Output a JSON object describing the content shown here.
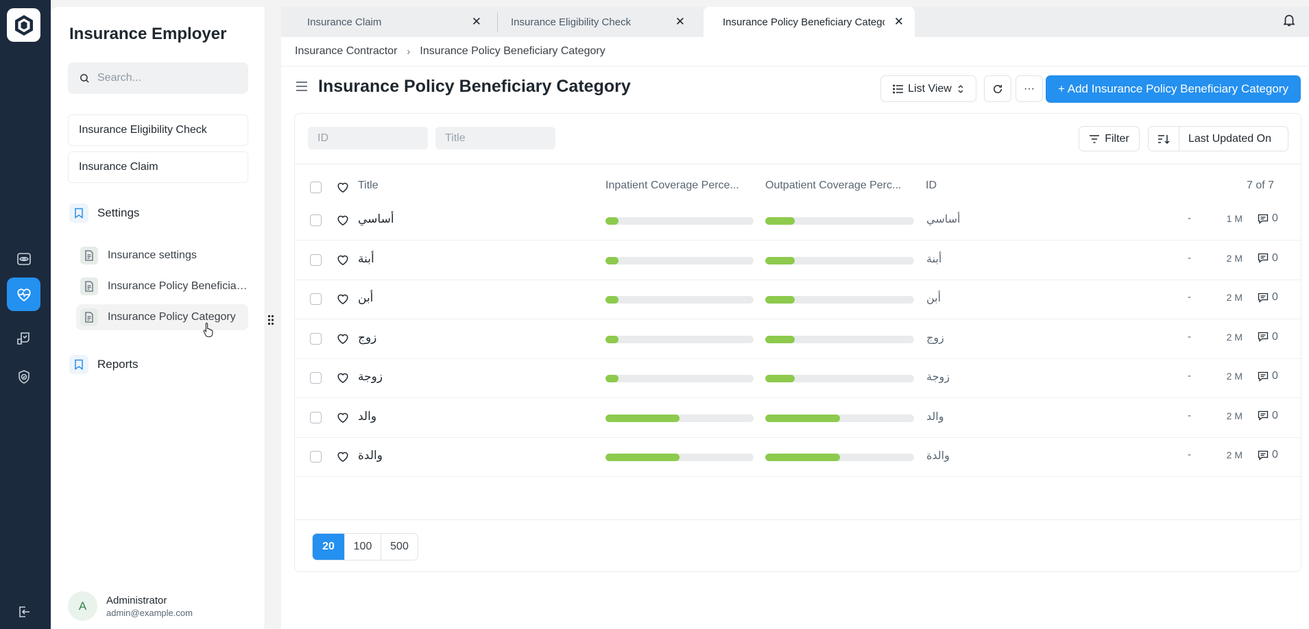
{
  "app": {
    "title": "Insurance Employer"
  },
  "rail": {
    "items": [
      "app-logo",
      "eye-scan-icon",
      "heart-pulse-icon",
      "hand-shield-icon",
      "shield-check-icon",
      "logout-icon"
    ],
    "active": "heart-pulse-icon"
  },
  "sidebar": {
    "search_placeholder": "Search...",
    "shortcuts": [
      "Insurance Eligibility Check",
      "Insurance Claim"
    ],
    "settings_label": "Settings",
    "settings_items": [
      "Insurance settings",
      "Insurance Policy Beneficiary Category",
      "Insurance Policy Category"
    ],
    "active_item": "Insurance Policy Category",
    "reports_label": "Reports",
    "user": {
      "initial": "A",
      "name": "Administrator",
      "email": "admin@example.com"
    }
  },
  "tabs": [
    {
      "label": "Insurance Claim",
      "close": "✕"
    },
    {
      "label": "Insurance Eligibility Check",
      "close": "✕"
    },
    {
      "label": "Insurance Policy Beneficiary Category",
      "close": "✕",
      "active": true
    }
  ],
  "breadcrumb": [
    "Insurance Contractor",
    "Insurance Policy Beneficiary Category"
  ],
  "breadcrumb_sep": "›",
  "page": {
    "title": "Insurance Policy Beneficiary Category",
    "view_label": "List View",
    "more_label": "···",
    "add_label": "+ Add Insurance Policy Beneficiary Category"
  },
  "filters": {
    "id_placeholder": "ID",
    "title_placeholder": "Title",
    "filter_label": "Filter",
    "sort_label": "Last Updated On"
  },
  "table": {
    "columns": [
      "Title",
      "Inpatient Coverage Perce...",
      "Outpatient Coverage Perc...",
      "ID"
    ],
    "count": "7 of 7",
    "rows": [
      {
        "title": "أساسي",
        "id": "أساسي",
        "inpatient": 0.09,
        "outpatient": 0.2,
        "dash": "-",
        "modified": "1 M",
        "comments": "0"
      },
      {
        "title": "أبنة",
        "id": "أبنة",
        "inpatient": 0.09,
        "outpatient": 0.2,
        "dash": "-",
        "modified": "2 M",
        "comments": "0"
      },
      {
        "title": "أبن",
        "id": "أبن",
        "inpatient": 0.09,
        "outpatient": 0.2,
        "dash": "-",
        "modified": "2 M",
        "comments": "0"
      },
      {
        "title": "زوج",
        "id": "زوج",
        "inpatient": 0.09,
        "outpatient": 0.2,
        "dash": "-",
        "modified": "2 M",
        "comments": "0"
      },
      {
        "title": "زوجة",
        "id": "زوجة",
        "inpatient": 0.09,
        "outpatient": 0.2,
        "dash": "-",
        "modified": "2 M",
        "comments": "0"
      },
      {
        "title": "والد",
        "id": "والد",
        "inpatient": 0.5,
        "outpatient": 0.5,
        "dash": "-",
        "modified": "2 M",
        "comments": "0"
      },
      {
        "title": "والدة",
        "id": "والدة",
        "inpatient": 0.5,
        "outpatient": 0.5,
        "dash": "-",
        "modified": "2 M",
        "comments": "0"
      }
    ]
  },
  "pagination": {
    "sizes": [
      "20",
      "100",
      "500"
    ],
    "active": "20"
  },
  "colors": {
    "accent": "#2490ef",
    "rail": "#1c2a3e",
    "progress": "#8dca4d"
  }
}
